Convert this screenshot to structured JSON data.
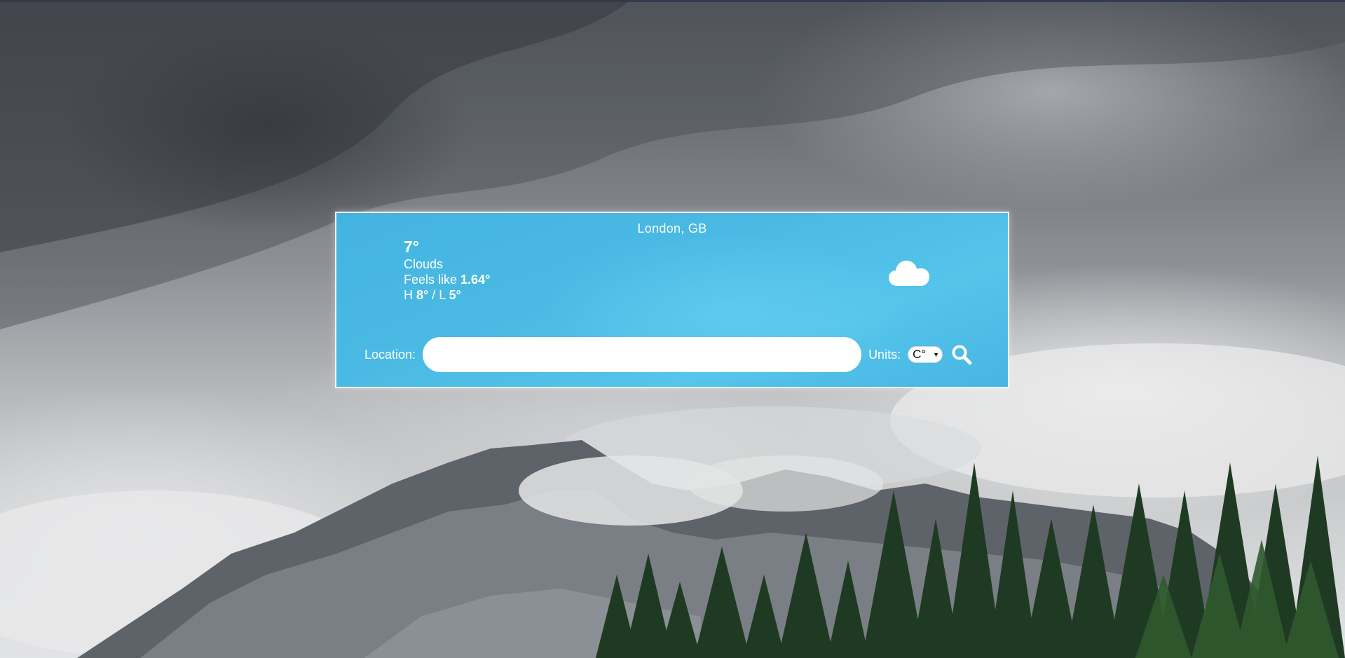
{
  "weather": {
    "location": "London, GB",
    "temperature": "7°",
    "condition": "Clouds",
    "feels_like_label": "Feels like",
    "feels_like_value": "1.64°",
    "high_label": "H",
    "high_value": "8°",
    "separator": "/",
    "low_label": "L",
    "low_value": "5°",
    "icon": "cloud-icon"
  },
  "search": {
    "location_label": "Location:",
    "location_value": "",
    "location_placeholder": "",
    "units_label": "Units:",
    "units_selected": "C°",
    "search_icon": "search-icon"
  },
  "colors": {
    "card_accent": "#4ab9e3",
    "text": "#ffffff"
  }
}
